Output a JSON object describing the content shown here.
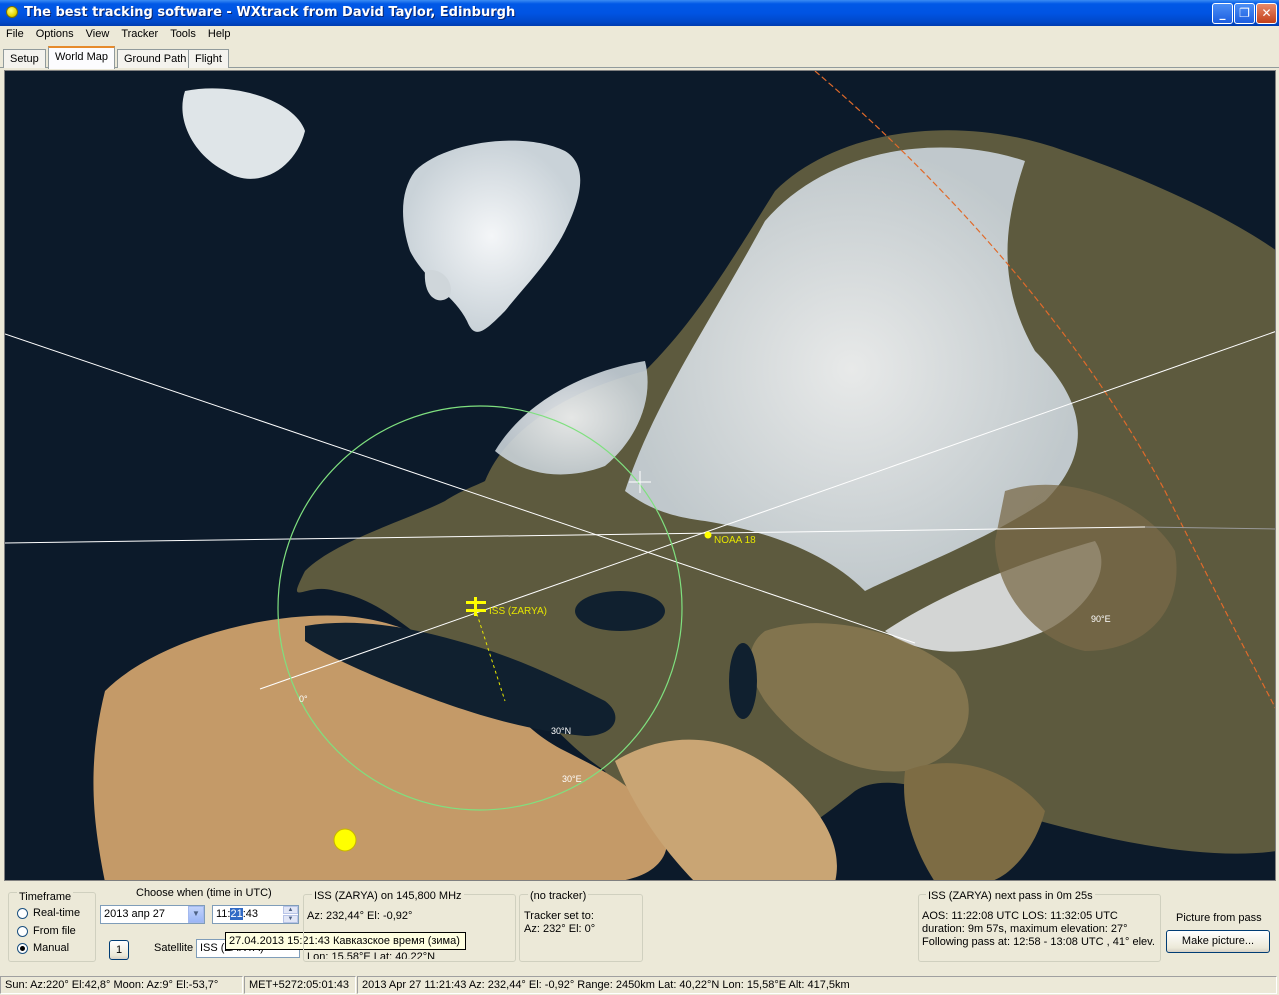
{
  "window": {
    "title": "The best tracking software - WXtrack from David Taylor, Edinburgh",
    "minimize": "_",
    "maximize": "❐",
    "close": "✕"
  },
  "menu": [
    "File",
    "Options",
    "View",
    "Tracker",
    "Tools",
    "Help"
  ],
  "tabs": [
    "Setup",
    "World Map",
    "Ground Path",
    "Flight"
  ],
  "active_tab": "World Map",
  "map": {
    "satellites": [
      {
        "name": "ISS (ZARYA)",
        "color": "#ffff00"
      },
      {
        "name": "NOAA 18",
        "color": "#ffff00"
      }
    ],
    "grid_labels": [
      "0°",
      "30°N",
      "30°E",
      "90°E"
    ],
    "colors": {
      "ocean": "#0c1a2a",
      "footprint": "#7fe07f",
      "track": "#ffffff",
      "terminator": "#e06a2a"
    }
  },
  "timeframe": {
    "legend": "Timeframe",
    "options": [
      "Real-time",
      "From file",
      "Manual"
    ],
    "selected": "Manual"
  },
  "choose_when": {
    "legend": "Choose when (time in UTC)",
    "date": "2013 апр  27",
    "time_prefix": "11:",
    "time_selected": "21",
    "time_suffix": ":43",
    "step_button": "1",
    "satellite_label": "Satellite",
    "satellite_value": "ISS (ZARYA)"
  },
  "tooltip": "27.04.2013 15:21:43  Кавказское время (зима)",
  "sat_info": {
    "legend": "ISS (ZARYA) on 145,800 MHz",
    "line1": "Az: 232,44°  El: -0,92°",
    "line2": "Lon: 15,58°E  Lat: 40,22°N"
  },
  "tracker": {
    "legend": "(no tracker)",
    "line1": "Tracker set to:",
    "line2": "Az: 232°  El: 0°"
  },
  "next_pass": {
    "legend": "ISS (ZARYA) next pass in 0m 25s",
    "line1": "AOS: 11:22:08 UTC  LOS: 11:32:05 UTC",
    "line2": "duration: 9m 57s,  maximum elevation: 27°",
    "line3": "Following pass at: 12:58 - 13:08 UTC , 41° elev."
  },
  "picture": {
    "label": "Picture from pass",
    "button": "Make picture..."
  },
  "status": [
    "Sun: Az:220° El:42,8°  Moon: Az:9° El:-53,7°",
    "MET+5272:05:01:43",
    "2013 Apr 27  11:21:43  Az: 232,44°  El: -0,92°  Range: 2450km  Lat: 40,22°N  Lon: 15,58°E  Alt: 417,5km"
  ]
}
